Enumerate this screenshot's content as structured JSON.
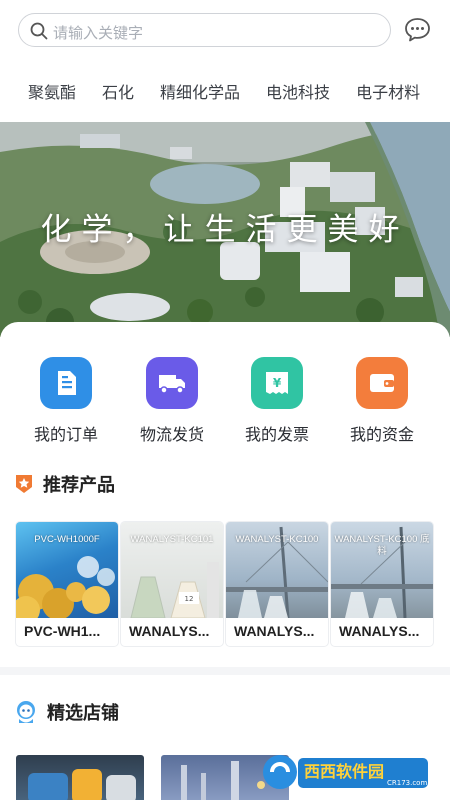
{
  "search": {
    "placeholder": "请输入关键字"
  },
  "categories": [
    "聚氨酯",
    "石化",
    "精细化学品",
    "电池科技",
    "电子材料"
  ],
  "banner": {
    "slogan": "化学，让生活更美好"
  },
  "actions": [
    {
      "label": "我的订单",
      "icon": "order-icon",
      "color": "#2f8fe6"
    },
    {
      "label": "物流发货",
      "icon": "truck-icon",
      "color": "#6a5be8"
    },
    {
      "label": "我的发票",
      "icon": "invoice-icon",
      "color": "#30c4a3"
    },
    {
      "label": "我的资金",
      "icon": "wallet-icon",
      "color": "#f37d3c"
    }
  ],
  "recommended": {
    "title": "推荐产品",
    "items": [
      {
        "caption": "PVC-WH1000F",
        "name": "PVC-WH1..."
      },
      {
        "caption": "WANALYST-KC101",
        "name": "WANALYS..."
      },
      {
        "caption": "WANALYST-KC100",
        "name": "WANALYS..."
      },
      {
        "caption": "WANALYST-KC100 底料",
        "name": "WANALYS..."
      }
    ]
  },
  "stores": {
    "title": "精选店铺"
  },
  "watermark": {
    "text": "西西软件园",
    "sub": "CR173.com"
  }
}
